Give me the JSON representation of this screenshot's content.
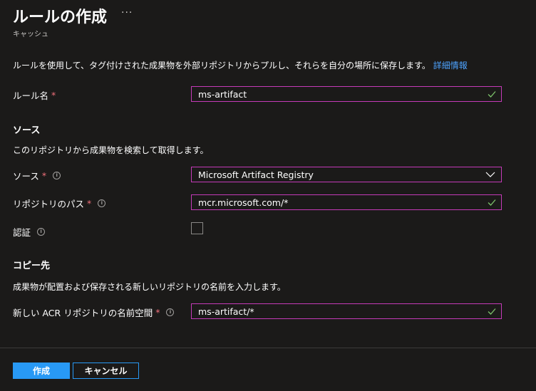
{
  "header": {
    "title": "ルールの作成",
    "more": "···",
    "subtitle": "キャッシュ"
  },
  "intro": {
    "text": "ルールを使用して、タグ付けされた成果物を外部リポジトリからプルし、それらを自分の場所に保存します。",
    "link": "詳細情報"
  },
  "rule_name": {
    "label": "ルール名",
    "required": "*",
    "value": "ms-artifact"
  },
  "source_section": {
    "heading": "ソース",
    "description": "このリポジトリから成果物を検索して取得します。",
    "source": {
      "label": "ソース",
      "required": "*",
      "value": "Microsoft Artifact Registry"
    },
    "repo_path": {
      "label": "リポジトリのパス",
      "required": "*",
      "value": "mcr.microsoft.com/*"
    },
    "auth": {
      "label": "認証",
      "checked": false
    }
  },
  "dest_section": {
    "heading": "コピー先",
    "description": "成果物が配置および保存される新しいリポジトリの名前を入力します。",
    "namespace": {
      "label": "新しい ACR リポジトリの名前空間",
      "required": "*",
      "value": "ms-artifact/*"
    }
  },
  "buttons": {
    "create": "作成",
    "cancel": "キャンセル"
  },
  "colors": {
    "accent": "#2899f5",
    "field_border": "#c53ab8",
    "required": "#f1707b",
    "valid": "#7cc26a",
    "link": "#4da3ff"
  }
}
